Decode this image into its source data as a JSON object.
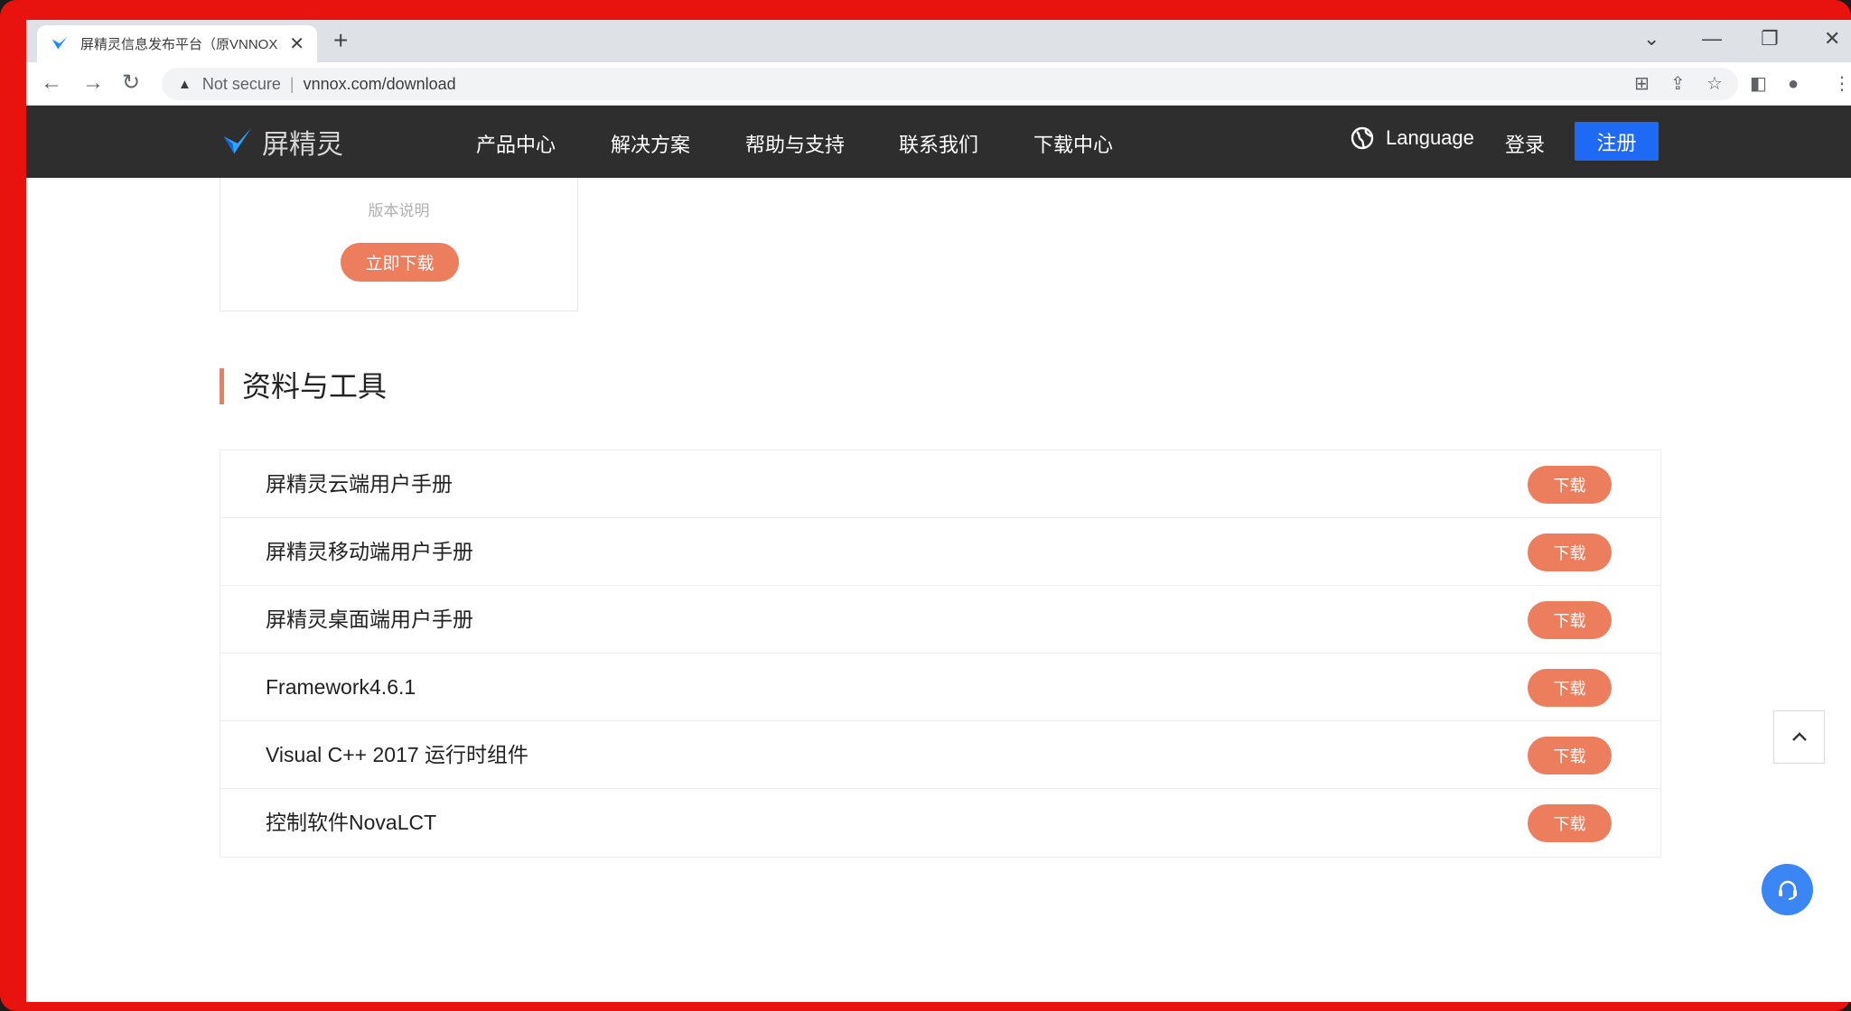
{
  "browser": {
    "tab_title": "屏精灵信息发布平台（原VNNOX",
    "tab_close": "✕",
    "new_tab": "+",
    "not_secure": "Not secure",
    "separator": "|",
    "url": "vnnox.com/download",
    "nav": {
      "back": "←",
      "forward": "→",
      "reload": "↻"
    },
    "window": {
      "dropdown": "⌄",
      "minimize": "—",
      "restore": "❐",
      "close": "✕"
    },
    "toolbar": {
      "translate": "⊞",
      "share": "⇪",
      "bookmark": "☆",
      "sidebar": "◧",
      "profile": "●",
      "menu": "⋮"
    }
  },
  "site": {
    "brand": "屏精灵",
    "nav": [
      "产品中心",
      "解决方案",
      "帮助与支持",
      "联系我们",
      "下载中心"
    ],
    "language": "Language",
    "login": "登录",
    "register": "注册"
  },
  "sdk_card": {
    "version_label": "版本说明",
    "download_label": "立即下载"
  },
  "section": {
    "title": "资料与工具"
  },
  "items": [
    {
      "name": "屏精灵云端用户手册",
      "action": "下载"
    },
    {
      "name": "屏精灵移动端用户手册",
      "action": "下载"
    },
    {
      "name": "屏精灵桌面端用户手册",
      "action": "下载"
    },
    {
      "name": "Framework4.6.1",
      "action": "下载"
    },
    {
      "name": "Visual C++ 2017 运行时组件",
      "action": "下载"
    },
    {
      "name": "控制软件NovaLCT",
      "action": "下载"
    }
  ],
  "colors": {
    "accent": "#ec7d5d",
    "register": "#1f6af5",
    "header_bg": "#2e2e2e",
    "support": "#3b86f5"
  }
}
